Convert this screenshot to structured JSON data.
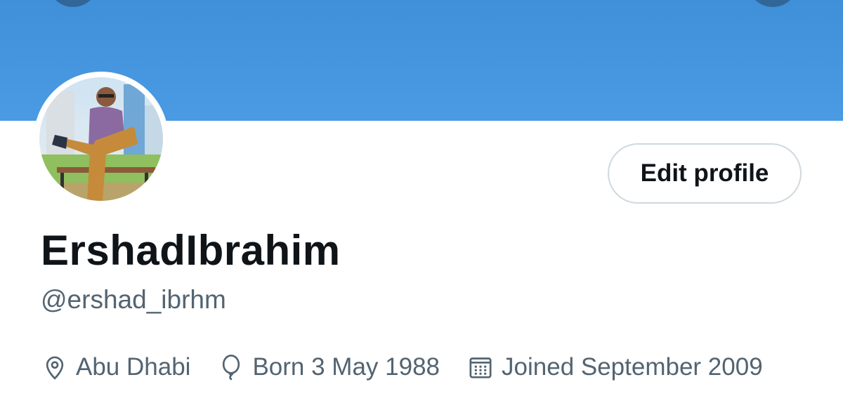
{
  "colors": {
    "banner": "#4a9ae4",
    "name_text": "#0f1419",
    "secondary_text": "#536471",
    "button_border": "#cfd9de"
  },
  "profile": {
    "display_name": "ErshadIbrahim",
    "handle": "@ershad_ibrhm",
    "avatar_icon": "profile-photo"
  },
  "actions": {
    "edit_profile_label": "Edit profile"
  },
  "meta": {
    "location": {
      "icon": "location-pin-icon",
      "text": "Abu Dhabi"
    },
    "birthday": {
      "icon": "balloon-icon",
      "text": "Born 3 May 1988"
    },
    "joined": {
      "icon": "calendar-icon",
      "text": "Joined September 2009"
    }
  }
}
